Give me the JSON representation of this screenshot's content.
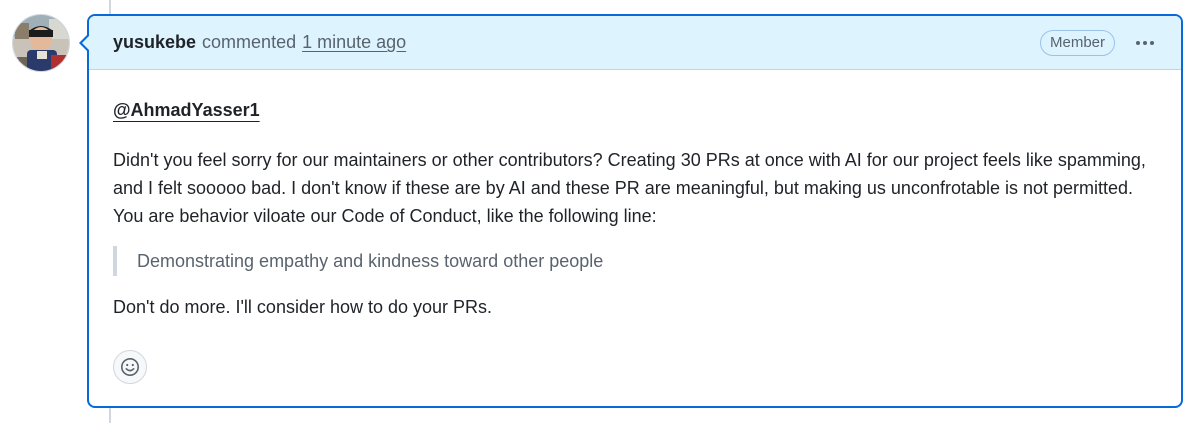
{
  "comment": {
    "author": "yusukebe",
    "action": "commented",
    "timestamp": "1 minute ago",
    "role_badge": "Member",
    "mention": "@AhmadYasser1",
    "paragraph1": "Didn't you feel sorry for our maintainers or other contributors? Creating 30 PRs at once with AI for our project feels like spamming, and I felt sooooo bad. I don't know if these are by AI and these PR are meaningful, but making us unconfrotable is not permitted. You are behavior viloate our Code of Conduct, like the following line:",
    "quote": "Demonstrating empathy and kindness toward other people",
    "paragraph2": "Don't do more. I'll consider how to do your PRs.",
    "icons": {
      "more": "kebab-horizontal-icon",
      "reaction": "smiley-icon"
    }
  },
  "colors": {
    "accent": "#0969da",
    "header_bg": "#ddf4ff",
    "muted_text": "#59636e"
  }
}
